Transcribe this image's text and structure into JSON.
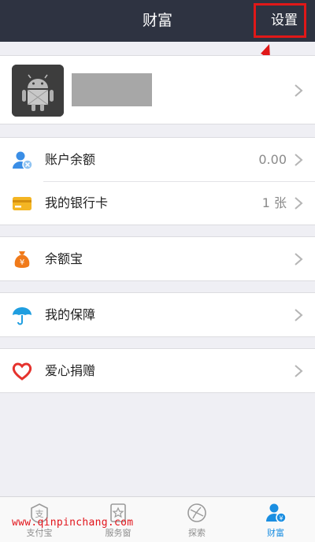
{
  "header": {
    "title": "财富",
    "settings_label": "设置"
  },
  "profile": {},
  "sections": {
    "balance": {
      "label": "账户余额",
      "value": "0.00"
    },
    "bankcard": {
      "label": "我的银行卡",
      "value": "1 张"
    },
    "yuebao": {
      "label": "余额宝"
    },
    "insurance": {
      "label": "我的保障"
    },
    "charity": {
      "label": "爱心捐赠"
    }
  },
  "tabs": [
    {
      "label": "支付宝"
    },
    {
      "label": "服务窗"
    },
    {
      "label": "探索"
    },
    {
      "label": "财富"
    }
  ],
  "watermark": "www.qinpinchang.com",
  "colors": {
    "header_bg": "#2e3341",
    "accent": "#1a8ee1",
    "annotation": "#e01818"
  }
}
